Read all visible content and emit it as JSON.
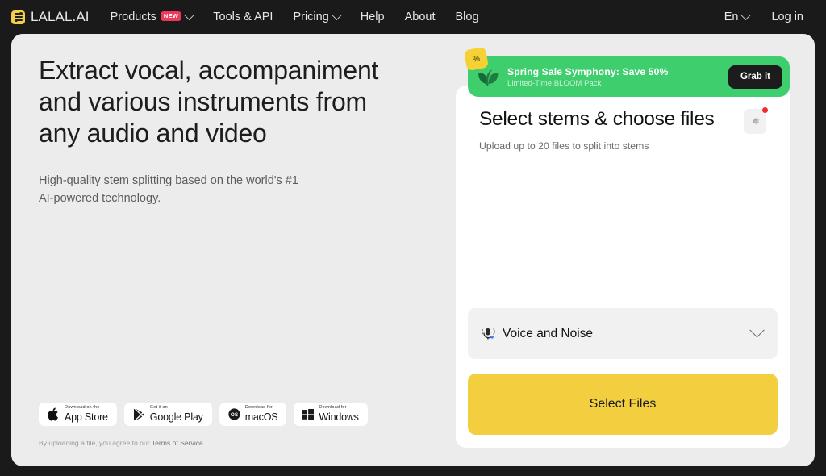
{
  "nav": {
    "brand": "LALAL.AI",
    "items": [
      {
        "label": "Products",
        "badge": "NEW",
        "caret": true
      },
      {
        "label": "Tools & API",
        "caret": false
      },
      {
        "label": "Pricing",
        "caret": true
      },
      {
        "label": "Help",
        "caret": false
      },
      {
        "label": "About",
        "caret": false
      },
      {
        "label": "Blog",
        "caret": false
      }
    ],
    "language": "En",
    "login": "Log in"
  },
  "hero": {
    "heading": "Extract vocal, accompaniment and various instruments from any audio and video",
    "subheading": "High-quality stem splitting based on the world's #1 AI-powered technology."
  },
  "stores": [
    {
      "id": "app-store",
      "icon": "apple-icon",
      "small": "Download on the",
      "big": "App Store"
    },
    {
      "id": "google-play",
      "icon": "google-play-icon",
      "small": "Get it on",
      "big": "Google Play"
    },
    {
      "id": "macos",
      "icon": "macos-icon",
      "small": "Download for",
      "big": "macOS"
    },
    {
      "id": "windows",
      "icon": "windows-icon",
      "small": "Download for",
      "big": "Windows"
    }
  ],
  "terms": {
    "prefix": "By uploading a file, you agree to our ",
    "link": "Terms of Service."
  },
  "promo": {
    "badge_symbol": "%",
    "icon": "leaf-icon",
    "title": "Spring Sale Symphony: Save 50%",
    "subtitle": "Limited-Time BLOOM Pack",
    "cta": "Grab it",
    "color": "#3ece6e"
  },
  "card": {
    "title": "Select stems & choose files",
    "subtitle": "Upload up to 20 files to split into stems",
    "settings_icon": "gear-icon",
    "stem_option": "Voice and Noise",
    "stem_icon": "voice-noise-icon",
    "select_files_label": "Select Files",
    "accent_color": "#f3cf3f"
  }
}
